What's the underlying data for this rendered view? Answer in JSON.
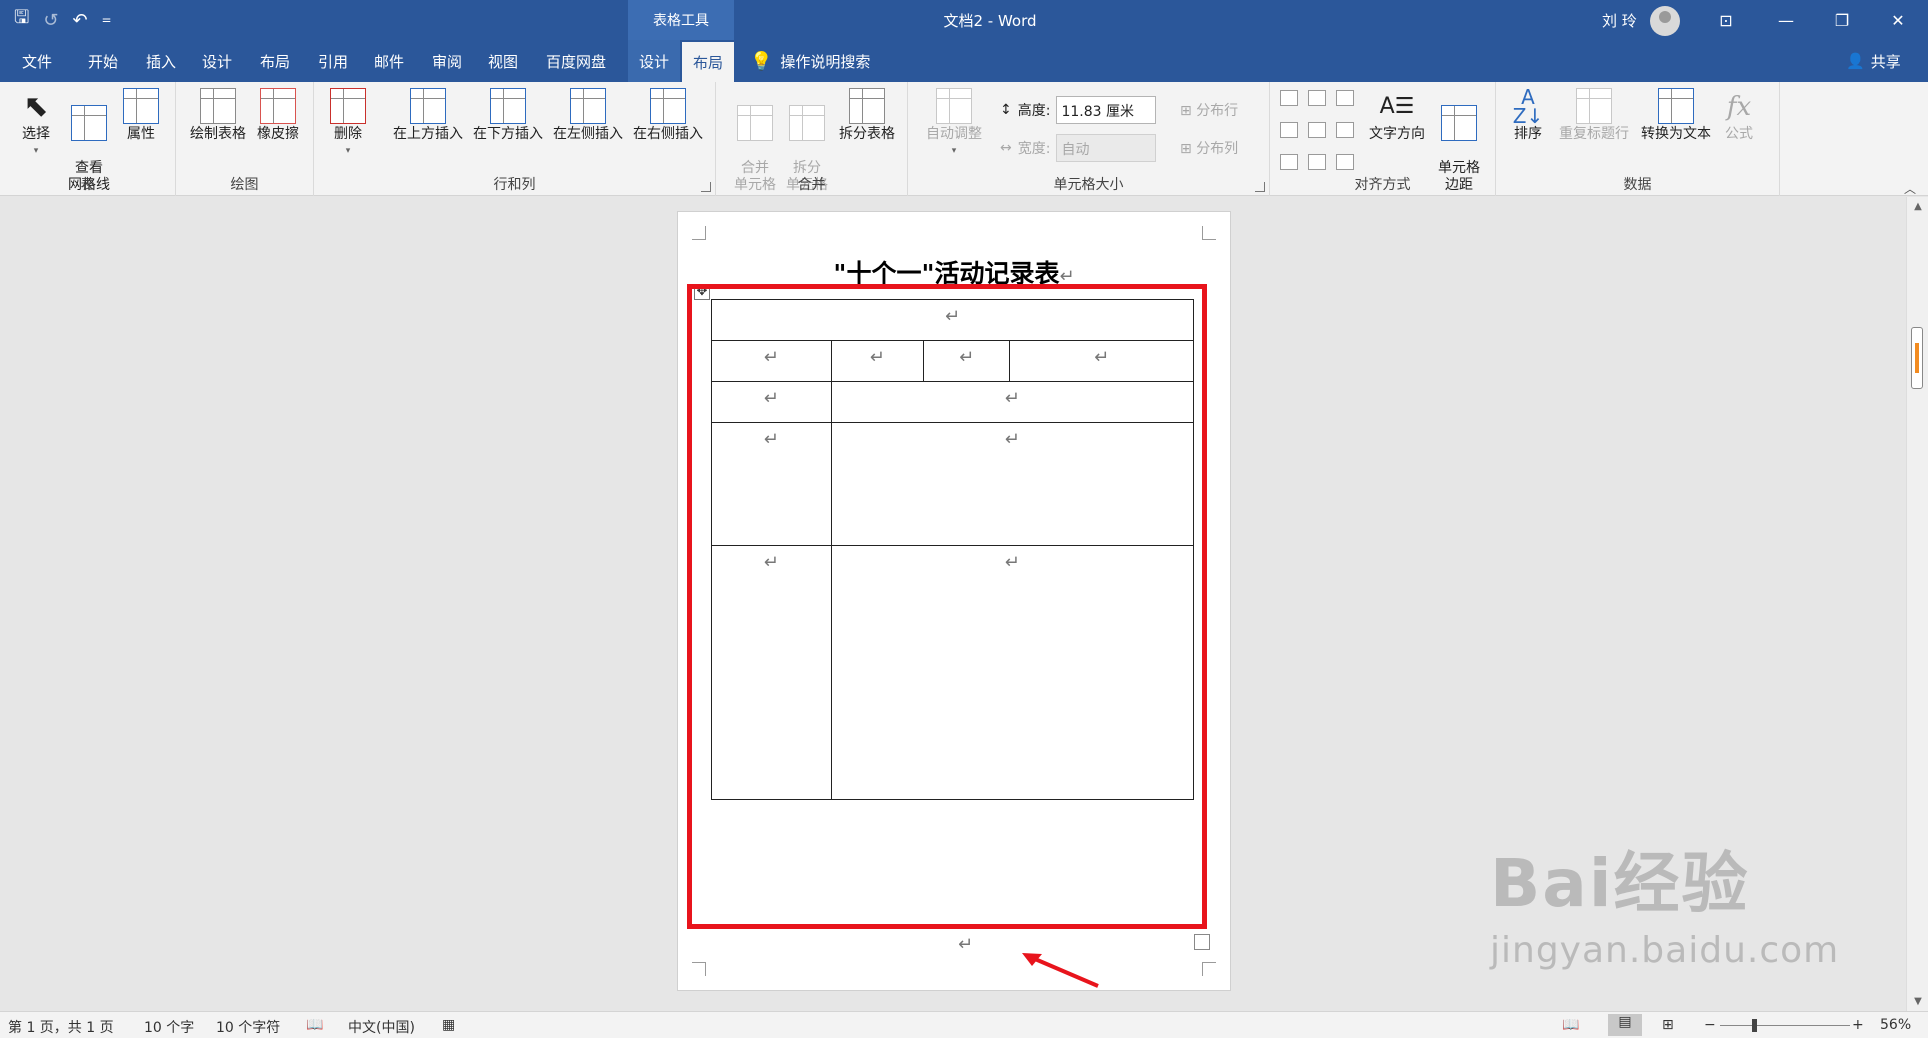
{
  "titlebar": {
    "context_tab_header": "表格工具",
    "doc_title": "文档2 - Word",
    "user_name": "刘 玲",
    "qat": {
      "save": "🖫",
      "redo": "↺",
      "undo": "↶",
      "customize": "="
    },
    "window_buttons": {
      "ribbon_options": "⊡",
      "minimize": "—",
      "restore": "❐",
      "close": "✕"
    }
  },
  "tabs": {
    "file": "文件",
    "home": "开始",
    "insert": "插入",
    "design": "设计",
    "layout": "布局",
    "references": "引用",
    "mailings": "邮件",
    "review": "审阅",
    "view": "视图",
    "baidu": "百度网盘",
    "table_design": "设计",
    "table_layout": "布局",
    "tell_me": "操作说明搜索",
    "share": "共享"
  },
  "ribbon": {
    "table": {
      "label": "表",
      "select": "选择",
      "view_gridlines": "查看\n网格线",
      "properties": "属性"
    },
    "draw": {
      "label": "绘图",
      "draw_table": "绘制表格",
      "eraser": "橡皮擦"
    },
    "rows_cols": {
      "label": "行和列",
      "delete": "删除",
      "insert_above": "在上方插入",
      "insert_below": "在下方插入",
      "insert_left": "在左侧插入",
      "insert_right": "在右侧插入"
    },
    "merge": {
      "label": "合并",
      "merge_cells": "合并\n单元格",
      "split_cells": "拆分\n单元格",
      "split_table": "拆分表格"
    },
    "cell_size": {
      "label": "单元格大小",
      "autofit": "自动调整",
      "height_label": "高度:",
      "height_value": "11.83 厘米",
      "width_label": "宽度:",
      "width_value": "自动",
      "distribute_rows": "分布行",
      "distribute_cols": "分布列"
    },
    "alignment": {
      "label": "对齐方式",
      "text_direction": "文字方向",
      "cell_margins": "单元格\n边距"
    },
    "data": {
      "label": "数据",
      "sort": "排序",
      "repeat_header": "重复标题行",
      "convert_to_text": "转换为文本",
      "formula": "公式"
    }
  },
  "document": {
    "heading": "\"十个一\"活动记录表",
    "paragraph_mark": "↵",
    "table_rows": [
      {
        "cells": [
          {
            "text": "↵",
            "colspan": 4
          }
        ]
      },
      {
        "cells": [
          {
            "text": "↵"
          },
          {
            "text": "↵"
          },
          {
            "text": "↵"
          },
          {
            "text": "↵"
          }
        ]
      },
      {
        "cells": [
          {
            "text": "↵"
          },
          {
            "text": "↵",
            "colspan": 3
          }
        ]
      },
      {
        "cells": [
          {
            "text": "↵"
          },
          {
            "text": "↵",
            "colspan": 3
          }
        ]
      },
      {
        "cells": [
          {
            "text": "↵"
          },
          {
            "text": "↵",
            "colspan": 3
          }
        ]
      }
    ]
  },
  "statusbar": {
    "page": "第 1 页，共 1 页",
    "words": "10 个字",
    "chars": "10 个字符",
    "language": "中文(中国)",
    "zoom": "56%"
  },
  "watermark": {
    "brand": "Bai经验",
    "url": "jingyan.baidu.com"
  },
  "colors": {
    "ribbon_blue": "#2b579a",
    "highlight_red": "#e8141c"
  }
}
